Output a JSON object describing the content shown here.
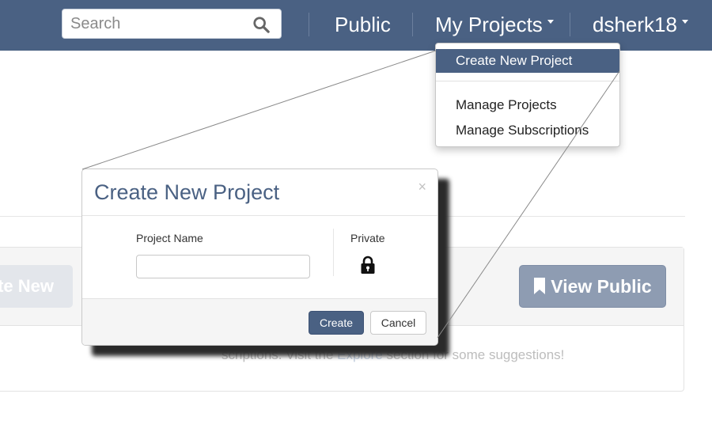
{
  "navbar": {
    "search": {
      "placeholder": "Search",
      "value": ""
    },
    "public_label": "Public",
    "my_projects_label": "My Projects",
    "user_label": "dsherk18"
  },
  "dropdown": {
    "items": [
      "Create New Project",
      "Manage Projects",
      "Manage Subscriptions"
    ],
    "active_index": 0
  },
  "background": {
    "left_button_label": "te New",
    "view_public_label": "View Public",
    "message_before": "scriptions. Visit the ",
    "message_link": "Explore",
    "message_after": " section for some suggestions!"
  },
  "modal": {
    "title": "Create New Project",
    "close_symbol": "×",
    "project_name_label": "Project Name",
    "project_name_value": "",
    "private_label": "Private",
    "create_label": "Create",
    "cancel_label": "Cancel"
  },
  "colors": {
    "navbar": "#4a6183",
    "primary_button": "#4a6183",
    "muted_button": "#8e9cb2",
    "title": "#4a6183"
  }
}
